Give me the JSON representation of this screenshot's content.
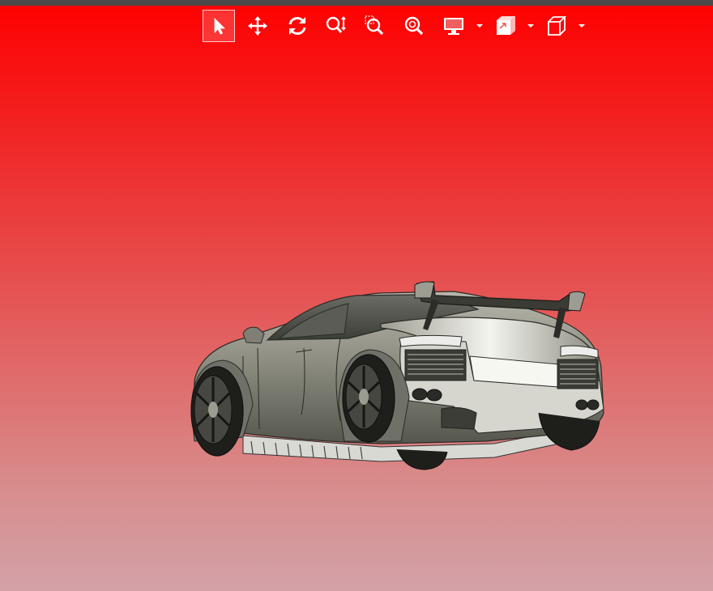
{
  "app": {
    "canvas": "3d-viewport",
    "background_gradient": [
      "#ff0000",
      "#d3a2a8"
    ],
    "topbar_color": "#4a4a4a"
  },
  "toolbar": {
    "tools": [
      {
        "id": "select",
        "icon": "select-arrow-icon",
        "active": true
      },
      {
        "id": "pan",
        "icon": "pan-move-icon",
        "active": false
      },
      {
        "id": "rotate",
        "icon": "rotate-icon",
        "active": false
      },
      {
        "id": "zoom",
        "icon": "zoom-icon",
        "active": false
      },
      {
        "id": "zoom-window",
        "icon": "zoom-window-icon",
        "active": false
      },
      {
        "id": "zoom-fit",
        "icon": "zoom-fit-icon",
        "active": false
      },
      {
        "id": "display-mode",
        "icon": "monitor-icon",
        "has_dropdown": true
      },
      {
        "id": "section",
        "icon": "section-view-icon",
        "has_dropdown": true
      },
      {
        "id": "standard-views",
        "icon": "cube-view-icon",
        "has_dropdown": true
      }
    ]
  },
  "model": {
    "type": "3d-car-model",
    "render_style": "shaded-with-edges",
    "body_color": "#9a9a8e"
  }
}
